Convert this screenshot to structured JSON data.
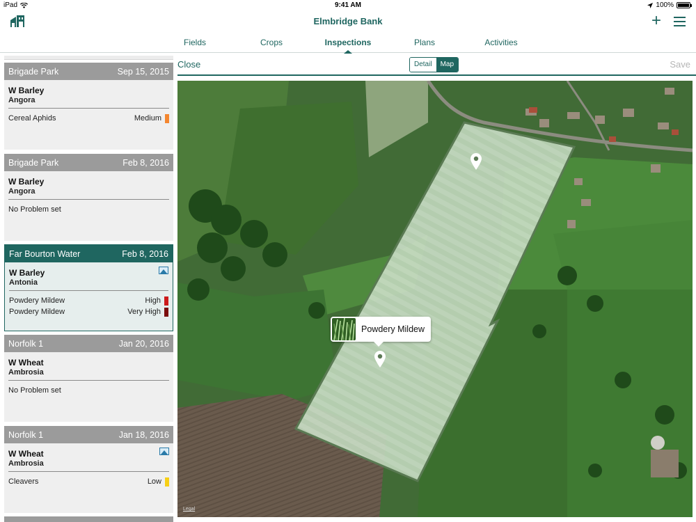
{
  "status": {
    "device": "iPad",
    "time": "9:41 AM",
    "battery": "100%"
  },
  "app": {
    "title": "Elmbridge Bank"
  },
  "tabs": [
    {
      "label": "Fields"
    },
    {
      "label": "Crops"
    },
    {
      "label": "Inspections"
    },
    {
      "label": "Plans"
    },
    {
      "label": "Activities"
    }
  ],
  "active_tab": "Inspections",
  "toolbar": {
    "close": "Close",
    "detail": "Detail",
    "map": "Map",
    "save": "Save"
  },
  "inspections": [
    {
      "field": "Brigade Park",
      "date": "Sep 15, 2015",
      "crop": "W Barley",
      "variety": "Angora",
      "problems": [
        {
          "name": "Cereal Aphids",
          "severity": "Medium",
          "color": "#f4862f"
        }
      ]
    },
    {
      "field": "Brigade Park",
      "date": "Feb 8, 2016",
      "crop": "W Barley",
      "variety": "Angora",
      "no_problem": "No Problem set"
    },
    {
      "field": "Far Bourton Water",
      "date": "Feb 8, 2016",
      "crop": "W Barley",
      "variety": "Antonia",
      "photo_icon": "photo-icon",
      "problems": [
        {
          "name": "Powdery Mildew",
          "severity": "High",
          "color": "#cc1a1a"
        },
        {
          "name": "Powdery Mildew",
          "severity": "Very High",
          "color": "#7a0d0d"
        }
      ]
    },
    {
      "field": "Norfolk 1",
      "date": "Jan 20, 2016",
      "crop": "W Wheat",
      "variety": "Ambrosia",
      "no_problem": "No Problem set"
    },
    {
      "field": "Norfolk 1",
      "date": "Jan 18, 2016",
      "crop": "W Wheat",
      "variety": "Ambrosia",
      "photo_icon": "photo-icon",
      "problems": [
        {
          "name": "Cleavers",
          "severity": "Low",
          "color": "#f7cf16"
        }
      ]
    }
  ],
  "map": {
    "callout": "Powdery Mildew",
    "legal": "Legal",
    "accent": "#1f6660"
  }
}
